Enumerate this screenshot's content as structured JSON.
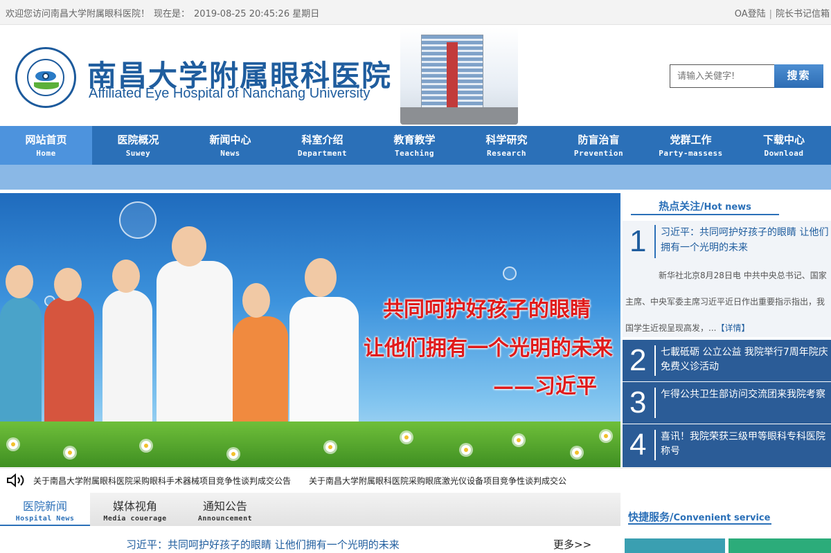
{
  "topbar": {
    "welcome": "欢迎您访问南昌大学附属眼科医院！",
    "time_label": "现在是：",
    "datetime": "2019-08-25 20:45:26 星期日",
    "oa_login": "OA登陆",
    "separator": "|",
    "director_mailbox": "院长书记信箱"
  },
  "header": {
    "title_cn": "南昌大学附属眼科医院",
    "title_en": "Affiliated Eye Hospital of Nanchang University",
    "search_placeholder": "请输入关健字!",
    "search_button": "搜索"
  },
  "nav": [
    {
      "cn": "网站首页",
      "en": "Home"
    },
    {
      "cn": "医院概况",
      "en": "Suwey"
    },
    {
      "cn": "新闻中心",
      "en": "News"
    },
    {
      "cn": "科室介绍",
      "en": "Department"
    },
    {
      "cn": "教育教学",
      "en": "Teaching"
    },
    {
      "cn": "科学研究",
      "en": "Research"
    },
    {
      "cn": "防盲治盲",
      "en": "Prevention"
    },
    {
      "cn": "党群工作",
      "en": "Party-massess"
    },
    {
      "cn": "下载中心",
      "en": "Download"
    }
  ],
  "banner": {
    "slogan_line1": "共同呵护好孩子的眼睛",
    "slogan_line2": "让他们拥有一个光明的未来",
    "slogan_line3": "——习近平"
  },
  "hot": {
    "title_cn": "热点关注/",
    "title_en": "Hot news",
    "items": [
      {
        "num": "1",
        "title": "习近平：共同呵护好孩子的眼睛 让他们拥有一个光明的未来",
        "desc": "新华社北京8月28日电 中共中央总书记、国家主席、中央军委主席习近平近日作出重要指示指出，我国学生近视呈现高发，...",
        "more": "【详情】"
      },
      {
        "num": "2",
        "title": "七載砥砺 公立公益 我院举行7周年院庆免费义诊活动"
      },
      {
        "num": "3",
        "title": "乍得公共卫生部访问交流团来我院考察"
      },
      {
        "num": "4",
        "title": "喜讯！我院荣获三级甲等眼科专科医院称号"
      }
    ]
  },
  "ticker": [
    "关于南昌大学附属眼科医院采购眼科手术器械项目竞争性谈判成交公告",
    "关于南昌大学附属眼科医院采购眼底激光仪设备项目竞争性谈判成交公"
  ],
  "tabs": [
    {
      "cn": "医院新闻",
      "en": "Hospital News"
    },
    {
      "cn": "媒体视角",
      "en": "Media couerage"
    },
    {
      "cn": "通知公告",
      "en": "Announcement"
    }
  ],
  "news": {
    "headline": "习近平：共同呵护好孩子的眼睛 让他们拥有一个光明的未来",
    "more": "更多>>"
  },
  "quick": {
    "title_cn": "快捷服务/",
    "title_en": "Convenient service"
  },
  "colors": {
    "brand_blue": "#2b70b8",
    "nav_active": "#4d93dd",
    "hot_row": "#2b5c97",
    "slogan_red": "#e01b1b"
  }
}
